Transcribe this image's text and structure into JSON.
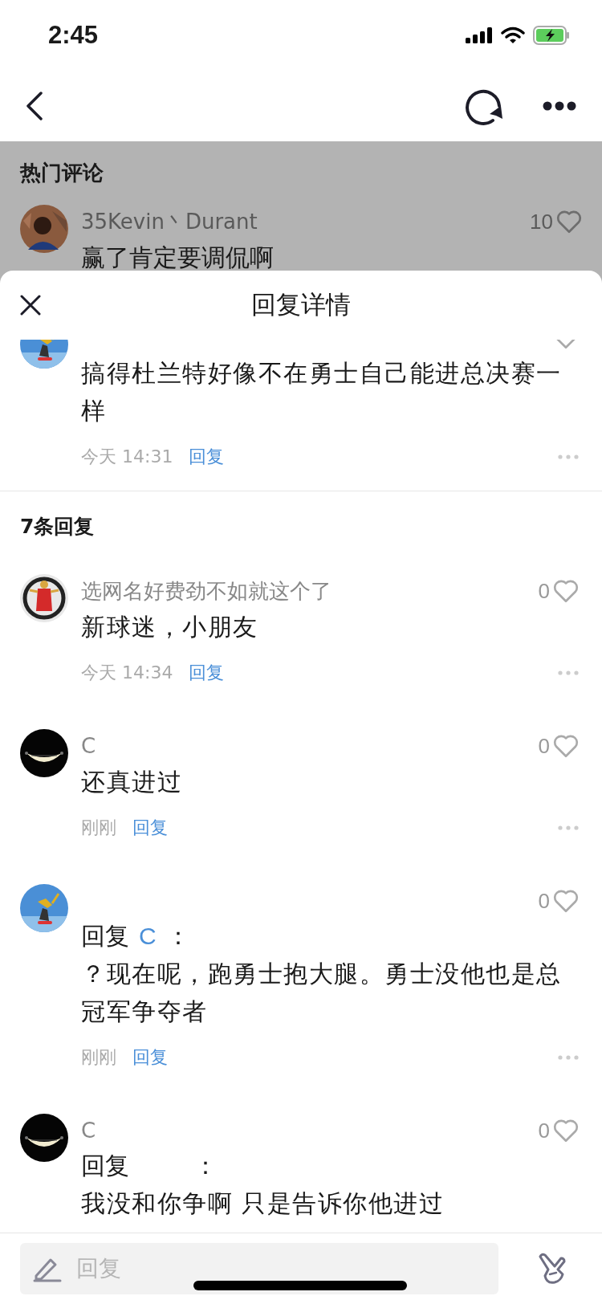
{
  "status_bar": {
    "time": "2:45"
  },
  "background": {
    "section_title": "热门评论",
    "comment": {
      "author": "35Kevin丶Durant",
      "likes": "10",
      "text": "赢了肯定要调侃啊"
    }
  },
  "sheet": {
    "title": "回复详情",
    "parent": {
      "text": "搞得杜兰特好像不在勇士自己能进总决赛一样",
      "time": "今天 14:31",
      "reply": "回复"
    },
    "count": "7条回复",
    "replies": [
      {
        "name": "选网名好费劲不如就这个了",
        "likes": "0",
        "text": "新球迷，小朋友",
        "time": "今天 14:34",
        "reply": "回复"
      },
      {
        "name": "C",
        "likes": "0",
        "text": "还真进过",
        "time": "刚刚",
        "reply": "回复"
      },
      {
        "likes": "0",
        "reply_to": {
          "label": "回复",
          "target": "C",
          "colon": "："
        },
        "text": "？现在呢，跑勇士抱大腿。勇士没他也是总冠军争夺者",
        "time": "刚刚",
        "reply": "回复"
      },
      {
        "name": "C",
        "likes": "0",
        "reply_to": {
          "label": "回复",
          "colon": "："
        },
        "text": "我没和你争啊 只是告诉你他进过"
      }
    ]
  },
  "composer": {
    "placeholder": "回复"
  }
}
